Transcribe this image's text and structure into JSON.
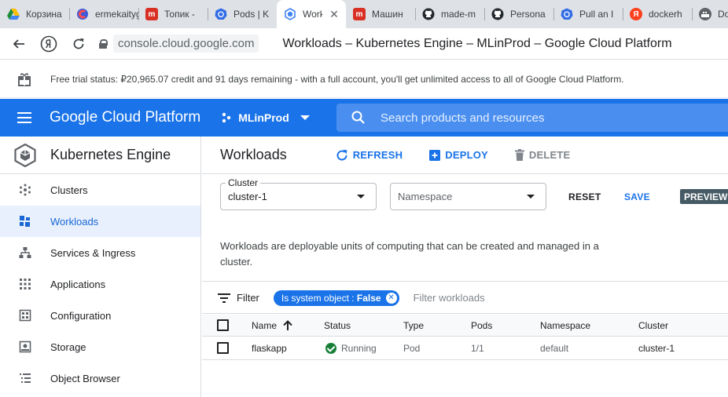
{
  "browser": {
    "tabs": [
      {
        "label": "Корзина",
        "icon": "google-drive-icon",
        "color": "#1e8e3e",
        "active": false
      },
      {
        "label": "ermekaitygulov",
        "icon": "app-favicon",
        "color": "#d93025",
        "active": false
      },
      {
        "label": "Топик -",
        "icon": "m-favicon",
        "color": "#d93025",
        "active": false
      },
      {
        "label": "Pods | K",
        "icon": "kubernetes-icon",
        "color": "#326ce5",
        "active": false
      },
      {
        "label": "Work",
        "icon": "kubernetes-engine-icon",
        "color": "#4285f4",
        "active": true
      },
      {
        "label": "Машин",
        "icon": "m-favicon",
        "color": "#d93025",
        "active": false
      },
      {
        "label": "made-m",
        "icon": "github-icon",
        "color": "#24292e",
        "active": false
      },
      {
        "label": "Persona",
        "icon": "github-icon",
        "color": "#24292e",
        "active": false
      },
      {
        "label": "Pull an I",
        "icon": "kubernetes-icon",
        "color": "#326ce5",
        "active": false
      },
      {
        "label": "dockerh",
        "icon": "yandex-icon",
        "color": "#fc3f1d",
        "active": false
      },
      {
        "label": "Do",
        "icon": "docker-icon",
        "color": "#5f6368",
        "active": false
      }
    ],
    "url": "console.cloud.google.com",
    "page_title": "Workloads – Kubernetes Engine – MLinProd – Google Cloud Platform"
  },
  "trial": {
    "text": "Free trial status: ₽20,965.07 credit and 91 days remaining - with a full account, you'll get unlimited access to all of Google Cloud Platform."
  },
  "header": {
    "title": "Google Cloud Platform",
    "project": "MLinProd",
    "search_placeholder": "Search products and resources"
  },
  "sidebar": {
    "title": "Kubernetes Engine",
    "items": [
      {
        "label": "Clusters",
        "icon": "clusters-icon",
        "active": false
      },
      {
        "label": "Workloads",
        "icon": "workloads-icon",
        "active": true
      },
      {
        "label": "Services & Ingress",
        "icon": "services-icon",
        "active": false
      },
      {
        "label": "Applications",
        "icon": "applications-icon",
        "active": false
      },
      {
        "label": "Configuration",
        "icon": "configuration-icon",
        "active": false
      },
      {
        "label": "Storage",
        "icon": "storage-icon",
        "active": false
      },
      {
        "label": "Object Browser",
        "icon": "object-browser-icon",
        "active": false
      }
    ]
  },
  "main": {
    "title": "Workloads",
    "refresh": "REFRESH",
    "deploy": "DEPLOY",
    "delete": "DELETE",
    "cluster_label": "Cluster",
    "cluster_value": "cluster-1",
    "namespace_placeholder": "Namespace",
    "reset": "RESET",
    "save": "SAVE",
    "preview": "PREVIEW",
    "description": "Workloads are deployable units of computing that can be created and managed in a cluster.",
    "filter_label": "Filter",
    "chip_key": "Is system object : ",
    "chip_value": "False",
    "filter_placeholder": "Filter workloads",
    "columns": [
      "Name",
      "Status",
      "Type",
      "Pods",
      "Namespace",
      "Cluster"
    ],
    "rows": [
      {
        "name": "flaskapp",
        "status": "Running",
        "type": "Pod",
        "pods": "1/1",
        "namespace": "default",
        "cluster": "cluster-1"
      }
    ]
  },
  "colors": {
    "brand_blue": "#1a73e8",
    "running_green": "#188038",
    "preview_badge": "#455a64"
  }
}
